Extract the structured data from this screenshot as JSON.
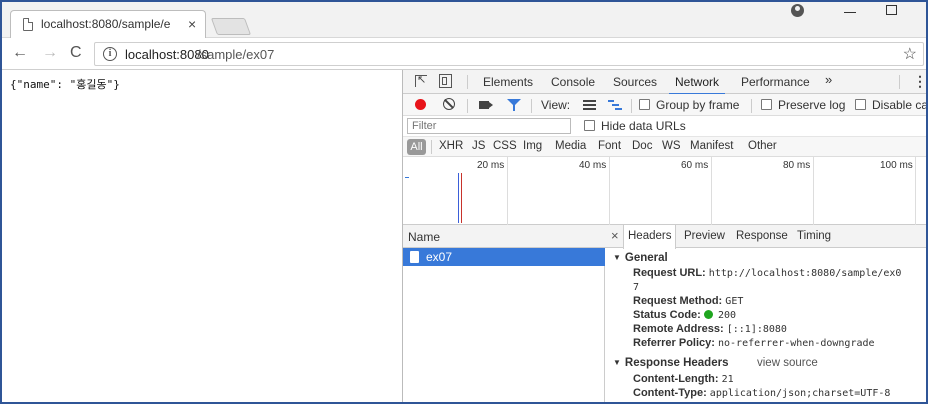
{
  "browser": {
    "tab_title": "localhost:8080/sample/e",
    "url_host": "localhost:8080",
    "url_path": "/sample/ex07"
  },
  "page": {
    "json_text": "{\"name\": \"홍길동\"}"
  },
  "devtools": {
    "tabs": [
      "Elements",
      "Console",
      "Sources",
      "Network",
      "Performance"
    ],
    "active_tab": "Network",
    "toolbar": {
      "view_label": "View:",
      "group_by_frame": "Group by frame",
      "preserve_log": "Preserve log",
      "disable_cache": "Disable ca"
    },
    "filter": {
      "placeholder": "Filter",
      "hide_data_urls": "Hide data URLs"
    },
    "types": [
      "All",
      "XHR",
      "JS",
      "CSS",
      "Img",
      "Media",
      "Font",
      "Doc",
      "WS",
      "Manifest",
      "Other"
    ],
    "overview_ticks": [
      "20 ms",
      "40 ms",
      "60 ms",
      "80 ms",
      "100 ms"
    ],
    "request_list": {
      "header": "Name",
      "rows": [
        "ex07"
      ]
    },
    "details": {
      "tabs": [
        "Headers",
        "Preview",
        "Response",
        "Timing"
      ],
      "active_tab": "Headers",
      "general_title": "General",
      "general": {
        "request_url_key": "Request URL:",
        "request_url_value": "http://localhost:8080/sample/ex0",
        "request_url_wrap": "7",
        "method_key": "Request Method:",
        "method_value": "GET",
        "status_key": "Status Code:",
        "status_value": "200",
        "remote_key": "Remote Address:",
        "remote_value": "[::1]:8080",
        "referrer_key": "Referrer Policy:",
        "referrer_value": "no-referrer-when-downgrade"
      },
      "response_headers_title": "Response Headers",
      "view_source": "view source",
      "response_headers": {
        "content_length_key": "Content-Length:",
        "content_length_value": "21",
        "content_type_key": "Content-Type:",
        "content_type_value": "application/json;charset=UTF-8"
      }
    }
  },
  "colors": {
    "accent": "#3879d9",
    "record": "#e8141a",
    "status_ok": "#1fa51f",
    "frame_border": "#2f5597"
  }
}
